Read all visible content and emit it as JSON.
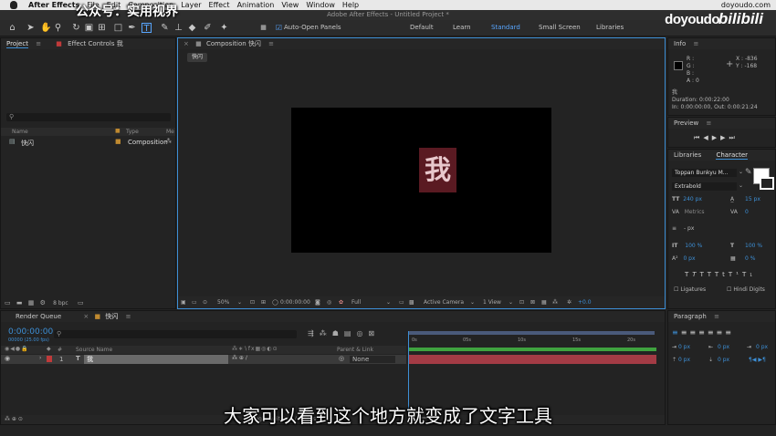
{
  "menubar": {
    "app_name": "After Effects",
    "items": [
      "File",
      "Edit",
      "Composition",
      "Layer",
      "Effect",
      "Animation",
      "View",
      "Window",
      "Help"
    ],
    "right_text": "doyoudo.com"
  },
  "window_title": "Adobe After Effects - Untitled Project *",
  "watermark": "公众号：实用视界",
  "brand": {
    "doyoudo": "doyoudo",
    "bilibili": "bilibili"
  },
  "toolbar": {
    "auto_open_label": "Auto-Open Panels",
    "workspaces": [
      "Default",
      "Learn",
      "Standard",
      "Small Screen",
      "Libraries"
    ]
  },
  "project": {
    "tab": "Project",
    "effect_controls_tab": "Effect Controls 我",
    "col_name": "Name",
    "col_type": "Type",
    "col_me": "Me",
    "item_name": "快闪",
    "item_type": "Composition",
    "bpc": "8 bpc"
  },
  "composition": {
    "tab": "Composition 快闪",
    "subtab": "快闪",
    "char": "我",
    "zoom": "50%",
    "timecode": "0:00:00:00",
    "resolution": "Full",
    "camera": "Active Camera",
    "view": "1 View",
    "exposure": "+0.0"
  },
  "info": {
    "tab": "Info",
    "r": "R :",
    "g": "G :",
    "b": "B :",
    "a": "A :  0",
    "x": "X : -836",
    "y": "Y : -168",
    "layer_name": "我",
    "duration": "Duration: 0:00:22:00",
    "inout": "In: 0:00:00:00, Out: 0:00:21:24"
  },
  "preview": {
    "tab": "Preview"
  },
  "character": {
    "libraries_tab": "Libraries",
    "tab": "Character",
    "font": "Toppan Bunkyu M...",
    "style": "Extrabold",
    "size": "240 px",
    "leading": "15 px",
    "kerning": "Metrics",
    "tracking": "0",
    "stroke": "- px",
    "vscale": "100 %",
    "hscale": "100 %",
    "baseline": "0 px",
    "tsume": "0 %",
    "ligatures": "Ligatures",
    "hindi": "Hindi Digits"
  },
  "paragraph": {
    "tab": "Paragraph",
    "values": [
      "0 px",
      "0 px",
      "0 px",
      "0 px",
      "0 px"
    ]
  },
  "timeline": {
    "render_queue_tab": "Render Queue",
    "comp_tab": "快闪",
    "timecode": "0:00:00:00",
    "fps": "00000 (25.00 fps)",
    "col_source": "Source Name",
    "col_parent": "Parent & Link",
    "layer_num": "1",
    "layer_name": "我",
    "parent_value": "None",
    "ruler": [
      "0s",
      "05s",
      "10s",
      "15s",
      "20s"
    ],
    "toggle_label": "Toggle Switches / Modes"
  },
  "subtitle": "大家可以看到这个地方就变成了文字工具",
  "colors": {
    "accent_blue": "#3d8fd6",
    "layer_bar": "#a33b45",
    "work_area": "#3fa33f",
    "char_bg": "#5a1a22",
    "char_fg": "#e8c8cc"
  }
}
